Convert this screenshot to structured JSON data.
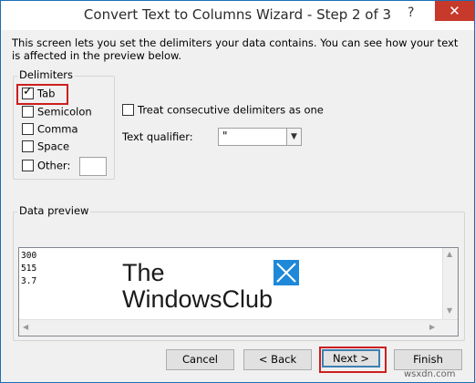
{
  "window": {
    "title": "Convert Text to Columns Wizard - Step 2 of 3",
    "help_glyph": "?",
    "close_glyph": "✕"
  },
  "description": "This screen lets you set the delimiters your data contains.  You can see how your text is affected in the preview below.",
  "delimiters": {
    "group_label": "Delimiters",
    "tab": {
      "label": "Tab",
      "checked": true
    },
    "semicolon": {
      "label": "Semicolon",
      "checked": false
    },
    "comma": {
      "label": "Comma",
      "checked": false
    },
    "space": {
      "label": "Space",
      "checked": false
    },
    "other": {
      "label": "Other:",
      "checked": false,
      "value": ""
    }
  },
  "consecutive": {
    "label": "Treat consecutive delimiters as one",
    "checked": false
  },
  "qualifier": {
    "label": "Text qualifier:",
    "selected": "\""
  },
  "preview": {
    "group_label": "Data preview",
    "lines": [
      "300",
      "515",
      "3.7"
    ]
  },
  "watermark": {
    "line1": "The",
    "line2": "WindowsClub",
    "site": "wsxdn.com"
  },
  "buttons": {
    "cancel": "Cancel",
    "back": "< Back",
    "next": "Next >",
    "finish": "Finish"
  },
  "colors": {
    "highlight": "#cc1f1f",
    "close_bg": "#c7392b",
    "logo_blue": "#1e88d9"
  }
}
